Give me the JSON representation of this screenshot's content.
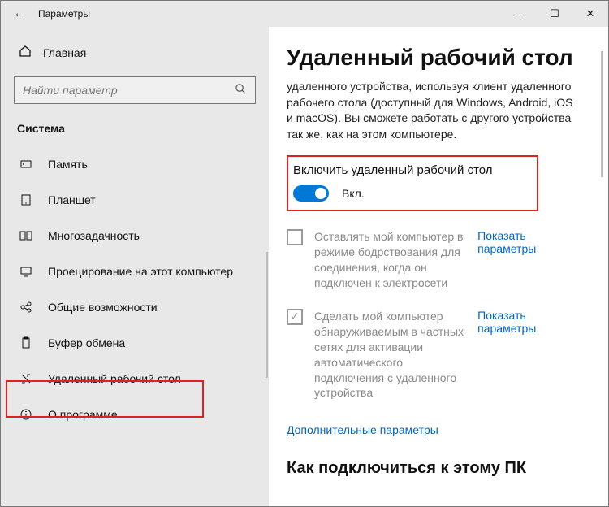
{
  "titlebar": {
    "back": "←",
    "title": "Параметры",
    "min": "—",
    "max": "☐",
    "close": "✕"
  },
  "home_label": "Главная",
  "search": {
    "placeholder": "Найти параметр"
  },
  "section": "Система",
  "nav": {
    "items": [
      {
        "label": "Память"
      },
      {
        "label": "Планшет"
      },
      {
        "label": "Многозадачность"
      },
      {
        "label": "Проецирование на этот компьютер"
      },
      {
        "label": "Общие возможности"
      },
      {
        "label": "Буфер обмена"
      },
      {
        "label": "Удаленный рабочий стол"
      },
      {
        "label": "О программе"
      }
    ]
  },
  "main": {
    "heading": "Удаленный рабочий стол",
    "intro": "удаленного устройства, используя клиент удаленного рабочего стола (доступный для Windows, Android, iOS и macOS). Вы сможете работать с другого устройства так же, как на этом компьютере.",
    "toggle_title": "Включить удаленный рабочий стол",
    "toggle_state": "Вкл.",
    "opt1": "Оставлять мой компьютер в режиме бодрствования для соединения, когда он подключен к электросети",
    "opt2": "Сделать мой компьютер обнаруживаемым в частных сетях для активации автоматического подключения с удаленного устройства",
    "show_params": "Показать параметры",
    "adv": "Дополнительные параметры",
    "h2": "Как подключиться к этому ПК"
  }
}
